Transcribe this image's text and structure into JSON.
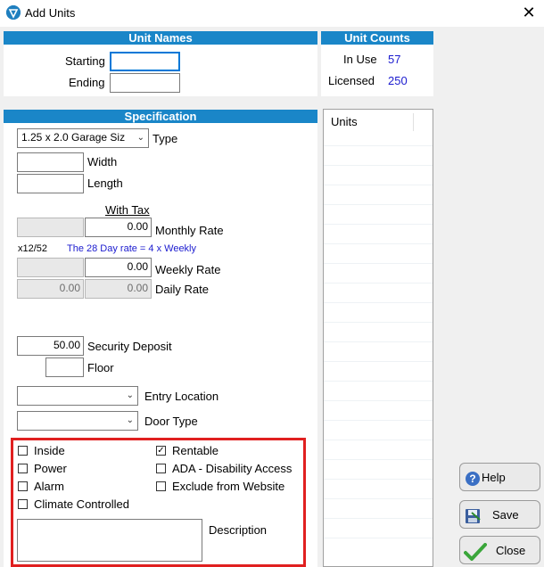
{
  "window": {
    "title": "Add Units",
    "close_glyph": "✕"
  },
  "unit_names": {
    "header": "Unit Names",
    "starting_label": "Starting",
    "starting_value": "",
    "ending_label": "Ending",
    "ending_value": ""
  },
  "unit_counts": {
    "header": "Unit Counts",
    "in_use_label": "In Use",
    "in_use_value": "57",
    "licensed_label": "Licensed",
    "licensed_value": "250"
  },
  "spec": {
    "header": "Specification",
    "type_value": "1.25 x 2.0 Garage Siz",
    "type_label": "Type",
    "width_label": "Width",
    "width_value": "",
    "length_label": "Length",
    "length_value": "",
    "with_tax_label": "With Tax",
    "monthly_rate_label": "Monthly Rate",
    "monthly_rate_value": "0.00",
    "x12_label": "x12/52",
    "day28_note": "The 28 Day rate = 4 x Weekly",
    "weekly_rate_label": "Weekly Rate",
    "weekly_rate_value": "0.00",
    "daily_rate_label": "Daily Rate",
    "daily_rate_value_1": "0.00",
    "daily_rate_value_2": "0.00",
    "security_deposit_label": "Security Deposit",
    "security_deposit_value": "50.00",
    "floor_label": "Floor",
    "floor_value": "",
    "entry_location_label": "Entry Location",
    "entry_location_value": "",
    "door_type_label": "Door Type",
    "door_type_value": ""
  },
  "options": {
    "inside": {
      "label": "Inside",
      "checked": false
    },
    "power": {
      "label": "Power",
      "checked": false
    },
    "alarm": {
      "label": "Alarm",
      "checked": false
    },
    "climate_controlled": {
      "label": "Climate Controlled",
      "checked": false
    },
    "rentable": {
      "label": "Rentable",
      "checked": true
    },
    "ada": {
      "label": "ADA - Disability Access",
      "checked": false
    },
    "exclude_website": {
      "label": "Exclude from Website",
      "checked": false
    },
    "description_label": "Description",
    "description_value": ""
  },
  "units_list": {
    "header": "Units"
  },
  "buttons": {
    "help": "Help",
    "save": "Save",
    "close": "Close"
  },
  "colors": {
    "section_header": "#1a86c8",
    "count_value": "#1b1bcf",
    "highlight_frame": "#e02020"
  }
}
